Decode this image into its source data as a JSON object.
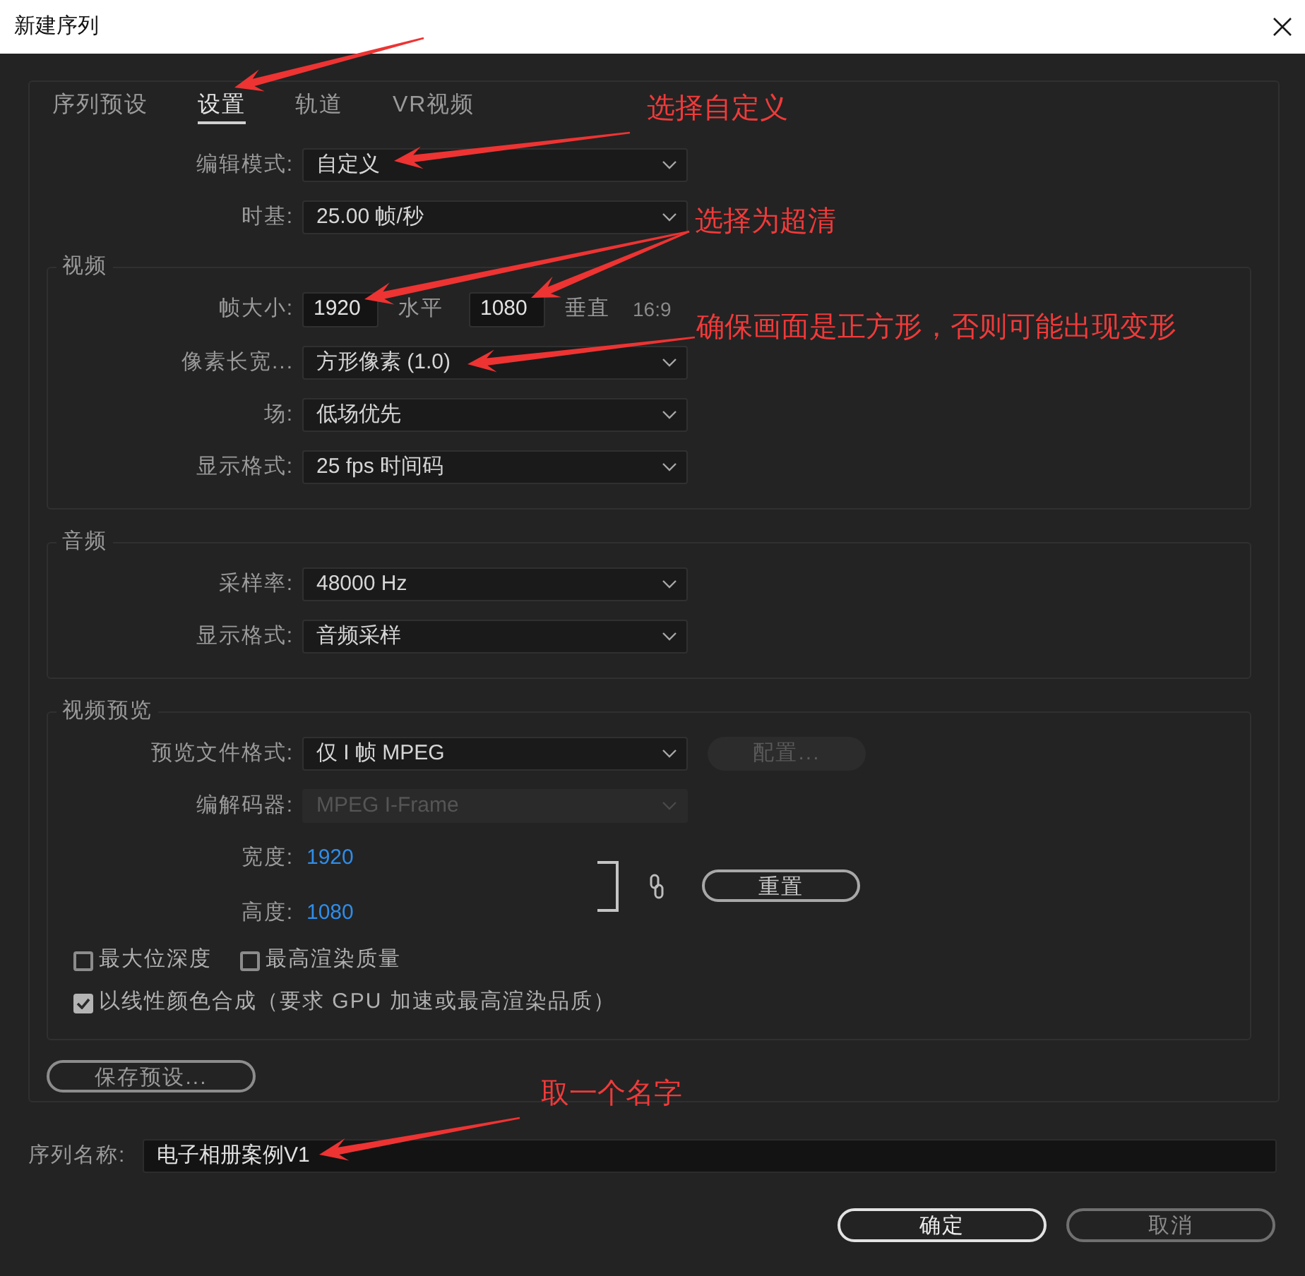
{
  "window": {
    "title": "新建序列"
  },
  "tabs": [
    {
      "label": "序列预设",
      "selected": false
    },
    {
      "label": "设置",
      "selected": true
    },
    {
      "label": "轨道",
      "selected": false
    },
    {
      "label": "VR视频",
      "selected": false
    }
  ],
  "general": [
    {
      "label": "编辑模式:",
      "value": "自定义",
      "disabled": false
    },
    {
      "label": "时基:",
      "value": "25.00 帧/秒",
      "disabled": false
    }
  ],
  "groups": [
    {
      "title": "视频",
      "rows": [
        {
          "kind": "frame_size",
          "label": "帧大小:",
          "fields": [
            {
              "value": "1920",
              "unit": "水平"
            },
            {
              "value": "1080",
              "unit": "垂直"
            }
          ],
          "aspect": "16:9"
        },
        {
          "kind": "dropdown",
          "label": "像素长宽...",
          "value": "方形像素 (1.0)",
          "disabled": false
        },
        {
          "kind": "dropdown",
          "label": "场:",
          "value": "低场优先",
          "disabled": false
        },
        {
          "kind": "dropdown",
          "label": "显示格式:",
          "value": "25 fps 时间码",
          "disabled": false
        }
      ]
    },
    {
      "title": "音频",
      "rows": [
        {
          "kind": "dropdown",
          "label": "采样率:",
          "value": "48000 Hz",
          "disabled": false
        },
        {
          "kind": "dropdown",
          "label": "显示格式:",
          "value": "音频采样",
          "disabled": false
        }
      ]
    },
    {
      "title": "视频预览",
      "rows": [
        {
          "kind": "dropdown",
          "label": "预览文件格式:",
          "value": "仅 I 帧 MPEG",
          "disabled": false,
          "button": {
            "label": "配置...",
            "disabled": true
          }
        },
        {
          "kind": "dropdown",
          "label": "编解码器:",
          "value": "MPEG I-Frame",
          "disabled": true
        },
        {
          "kind": "dimensions",
          "items": [
            {
              "label": "宽度:",
              "value": "1920"
            },
            {
              "label": "高度:",
              "value": "1080"
            }
          ],
          "button": "重置"
        },
        {
          "kind": "checkboxes",
          "items": [
            {
              "label": "最大位深度",
              "checked": false
            },
            {
              "label": "最高渲染质量",
              "checked": false
            }
          ]
        },
        {
          "kind": "checkboxes",
          "items": [
            {
              "label": "以线性颜色合成（要求 GPU 加速或最高渲染品质）",
              "checked": true
            }
          ]
        }
      ]
    }
  ],
  "save_preset_button": "保存预设...",
  "sequence_name": {
    "label": "序列名称:",
    "value": "电子相册案例V1"
  },
  "buttons": [
    {
      "label": "确定",
      "kind": "primary"
    },
    {
      "label": "取消",
      "kind": "secondary"
    }
  ],
  "annotations": [
    "选择自定义",
    "选择为超清",
    "确保画面是正方形，否则可能出现变形",
    "取一个名字"
  ]
}
